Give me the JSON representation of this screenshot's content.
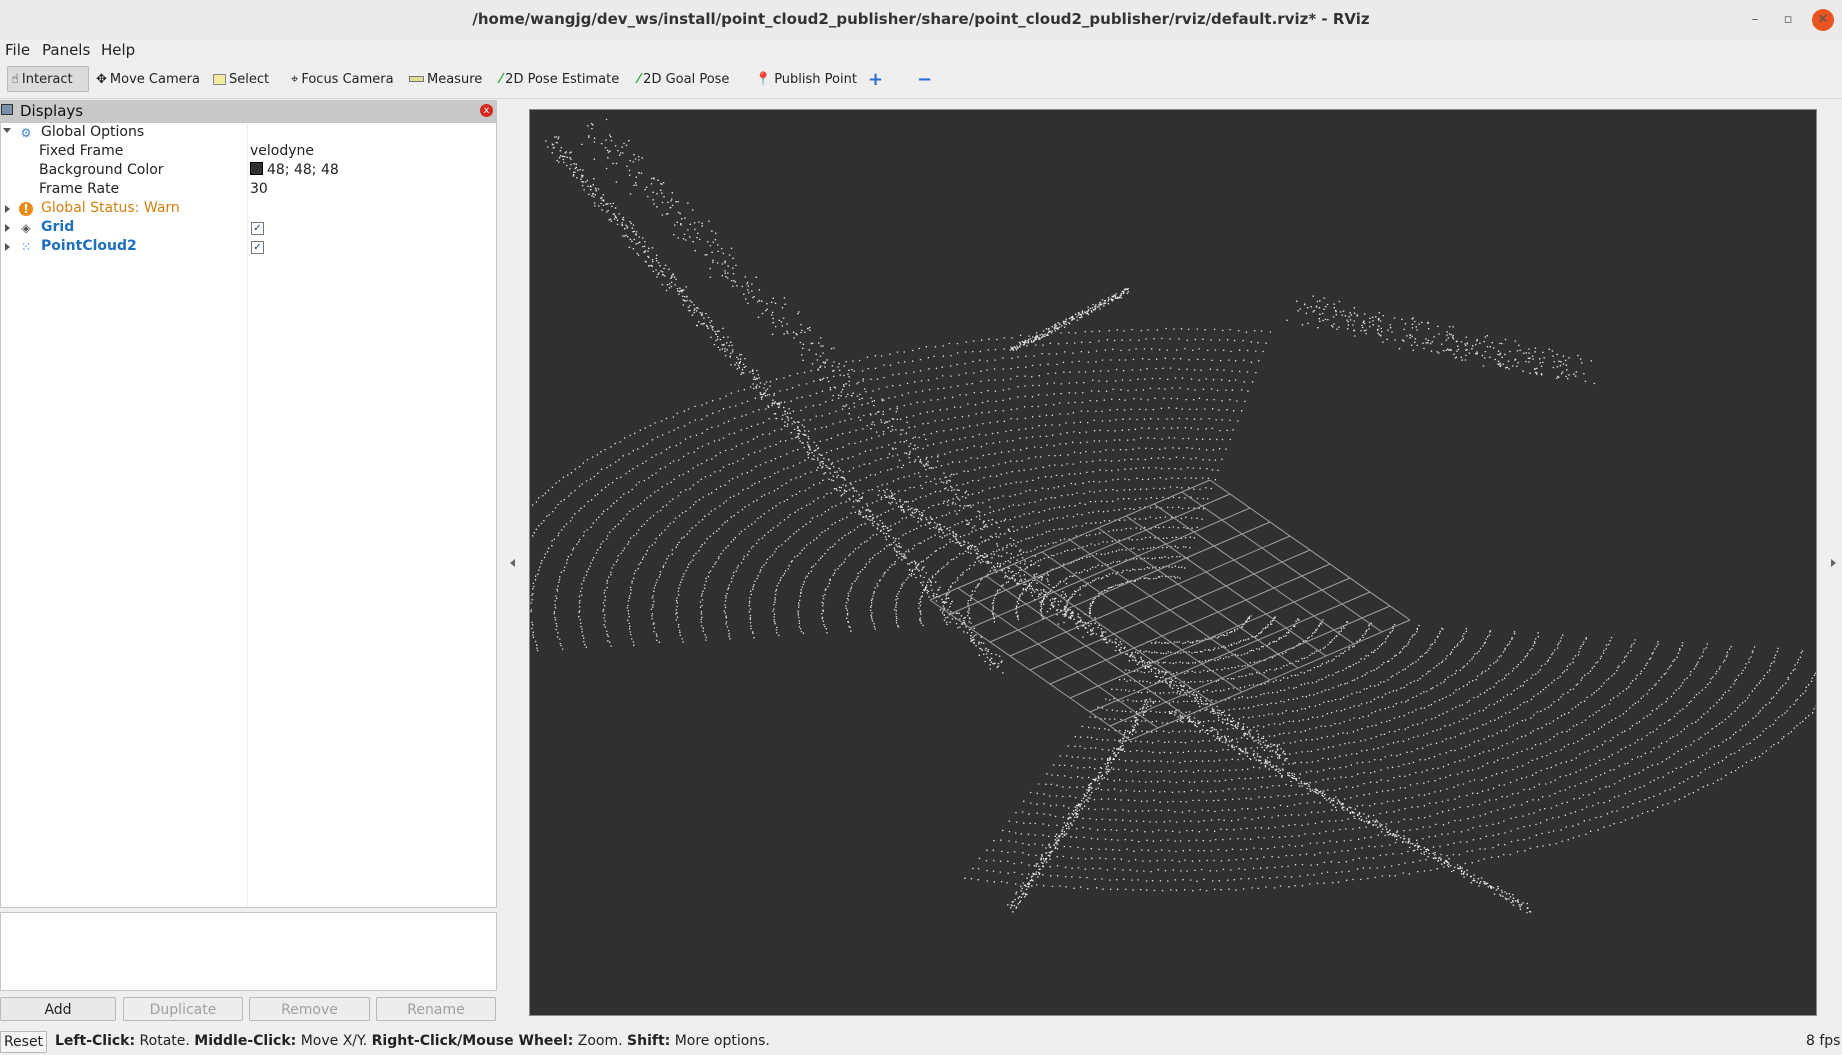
{
  "window": {
    "title": "/home/wangjg/dev_ws/install/point_cloud2_publisher/share/point_cloud2_publisher/rviz/default.rviz* - RViz",
    "minimize": "–",
    "maximize": "▫",
    "close": "✕"
  },
  "menubar": {
    "file_label": "File",
    "panels_label": "Panels",
    "help_label": "Help"
  },
  "toolbar": {
    "interact": "Interact",
    "move_camera": "Move Camera",
    "select": "Select",
    "focus_camera": "Focus Camera",
    "measure": "Measure",
    "pose_estimate": "2D Pose Estimate",
    "goal_pose": "2D Goal Pose",
    "publish_point": "Publish Point",
    "add_tool": "+",
    "remove_tool": "−"
  },
  "displays": {
    "title": "Displays",
    "close": "x",
    "global_options": {
      "label": "Global Options",
      "fixed_frame_label": "Fixed Frame",
      "fixed_frame_value": "velodyne",
      "background_color_label": "Background Color",
      "background_color_value": "48; 48; 48",
      "background_color_hex": "#303030",
      "frame_rate_label": "Frame Rate",
      "frame_rate_value": "30"
    },
    "global_status": "Global Status: Warn",
    "grid": {
      "label": "Grid",
      "checked": true,
      "check_glyph": "✓"
    },
    "pointcloud": {
      "label": "PointCloud2",
      "checked": true,
      "check_glyph": "✓"
    }
  },
  "buttons": {
    "add": "Add",
    "duplicate": "Duplicate",
    "remove": "Remove",
    "rename": "Rename"
  },
  "statusbar": {
    "reset": "Reset",
    "left_click_key": "Left-Click:",
    "left_click_val": " Rotate. ",
    "middle_click_key": "Middle-Click:",
    "middle_click_val": " Move X/Y. ",
    "right_click_key": "Right-Click/Mouse Wheel:",
    "right_click_val": " Zoom. ",
    "shift_key": "Shift:",
    "shift_val": " More options.",
    "fps": "8 fps"
  },
  "colors": {
    "viewport_bg": "#303030",
    "warn": "#d4810f",
    "link_blue": "#1f6fbf",
    "close_orange": "#e95420"
  }
}
